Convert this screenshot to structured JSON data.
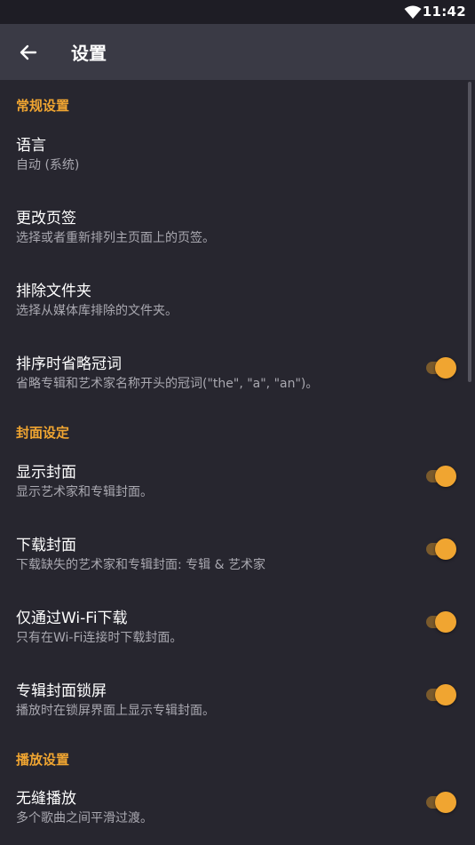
{
  "status_bar": {
    "time": "11:42",
    "icons": [
      "wifi-icon"
    ]
  },
  "app_bar": {
    "back_icon": "arrow-left-icon",
    "title": "设置"
  },
  "colors": {
    "accent": "#f0a531",
    "background": "#27262f",
    "app_bar": "#3a3a45",
    "status_bar": "#1e1d25",
    "summary_text": "#a9a8b0"
  },
  "sections": {
    "general": {
      "header": "常规设置",
      "language": {
        "label": "语言",
        "summary": "自动 (系统)"
      },
      "tabs": {
        "label": "更改页签",
        "summary": "选择或者重新排列主页面上的页签。"
      },
      "exclude_folders": {
        "label": "排除文件夹",
        "summary": "选择从媒体库排除的文件夹。"
      },
      "ignore_articles": {
        "label": "排序时省略冠词",
        "summary": "省略专辑和艺术家名称开头的冠词(\"the\", \"a\", \"an\")。",
        "enabled": true
      }
    },
    "artwork": {
      "header": "封面设定",
      "show_artwork": {
        "label": "显示封面",
        "summary": "显示艺术家和专辑封面。",
        "enabled": true
      },
      "download_artwork": {
        "label": "下载封面",
        "summary": "下载缺失的艺术家和专辑封面: 专辑 & 艺术家",
        "enabled": true
      },
      "wifi_only": {
        "label": "仅通过Wi-Fi下载",
        "summary": "只有在Wi-Fi连接时下载封面。",
        "enabled": true
      },
      "lockscreen_artwork": {
        "label": "专辑封面锁屏",
        "summary": "播放时在锁屏界面上显示专辑封面。",
        "enabled": true
      }
    },
    "playback": {
      "header": "播放设置",
      "gapless": {
        "label": "无缝播放",
        "summary": "多个歌曲之间平滑过渡。",
        "enabled": true
      }
    }
  }
}
